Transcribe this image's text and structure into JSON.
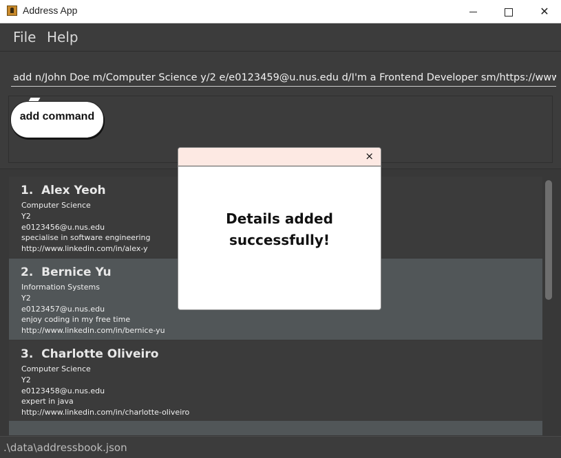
{
  "window": {
    "title": "Address App",
    "icon": "address-book-app-icon",
    "controls": [
      "minimize",
      "maximize",
      "close"
    ]
  },
  "menu": {
    "file": "File",
    "help": "Help"
  },
  "command_box": {
    "value": "add n/John Doe m/Computer Science y/2 e/e0123459@u.nus.edu d/I'm a Frontend Developer sm/https://www.linkedin"
  },
  "result_display": {
    "bubble_text": "add command"
  },
  "persons": [
    {
      "index": "1.",
      "name": "Alex Yeoh",
      "major": "Computer Science",
      "year": "Y2",
      "email": "e0123456@u.nus.edu",
      "description": "specialise in software engineering",
      "social": "http://www.linkedin.com/in/alex-y"
    },
    {
      "index": "2.",
      "name": "Bernice Yu",
      "major": "Information Systems",
      "year": "Y2",
      "email": "e0123457@u.nus.edu",
      "description": "enjoy coding in my free time",
      "social": "http://www.linkedin.com/in/bernice-yu"
    },
    {
      "index": "3.",
      "name": "Charlotte Oliveiro",
      "major": "Computer Science",
      "year": "Y2",
      "email": "e0123458@u.nus.edu",
      "description": "expert in java",
      "social": "http://www.linkedin.com/in/charlotte-oliveiro"
    }
  ],
  "popup": {
    "close_glyph": "×",
    "message_line1": "Details added",
    "message_line2": "successfully!"
  },
  "status_bar": {
    "path": ".\\data\\addressbook.json"
  },
  "colors": {
    "background": "#3c3c3c",
    "card_selected": "#515658",
    "popup_header": "#fde9e3"
  }
}
